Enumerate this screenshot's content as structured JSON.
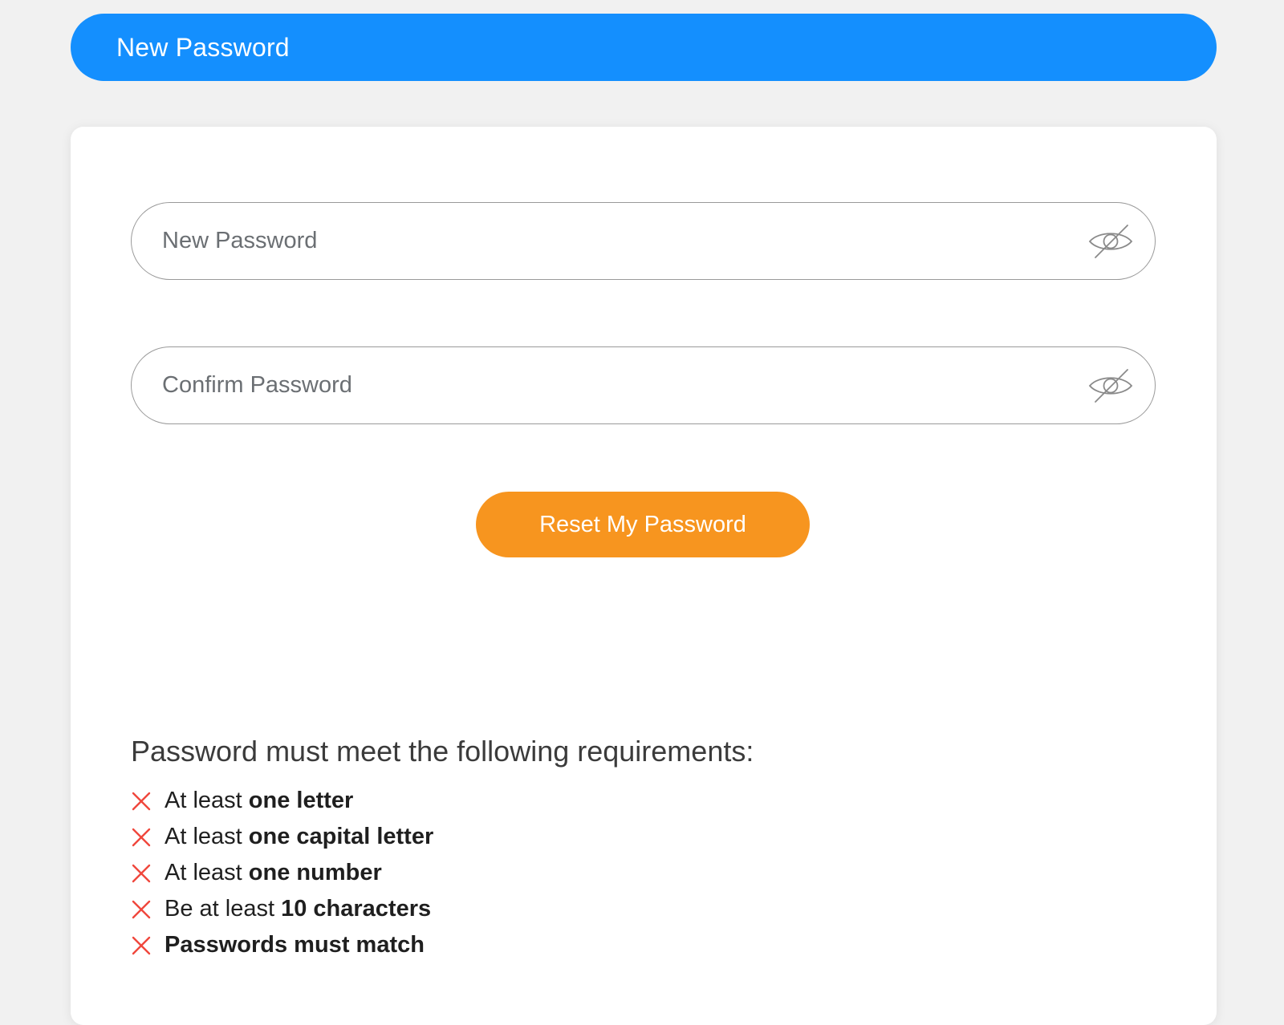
{
  "header": {
    "title": "New Password"
  },
  "form": {
    "new_password": {
      "placeholder": "New Password",
      "value": "",
      "toggle_icon": "eye-slash-icon"
    },
    "confirm_password": {
      "placeholder": "Confirm Password",
      "value": "",
      "toggle_icon": "eye-slash-icon"
    },
    "submit_label": "Reset My Password"
  },
  "requirements": {
    "heading": "Password must meet the following requirements:",
    "status_icon": "x-icon",
    "items": [
      {
        "prefix": "At least ",
        "bold": "one letter",
        "met": false
      },
      {
        "prefix": "At least ",
        "bold": "one capital letter",
        "met": false
      },
      {
        "prefix": "At least ",
        "bold": "one number",
        "met": false
      },
      {
        "prefix": "Be at least ",
        "bold": "10 characters",
        "met": false
      },
      {
        "prefix": "",
        "bold": "Passwords must match",
        "met": false
      }
    ]
  },
  "colors": {
    "background": "#f1f1f1",
    "header": "#148ffe",
    "button": "#f7951f",
    "unmet_icon": "#f0473c",
    "field_border": "#9a9a9a"
  }
}
